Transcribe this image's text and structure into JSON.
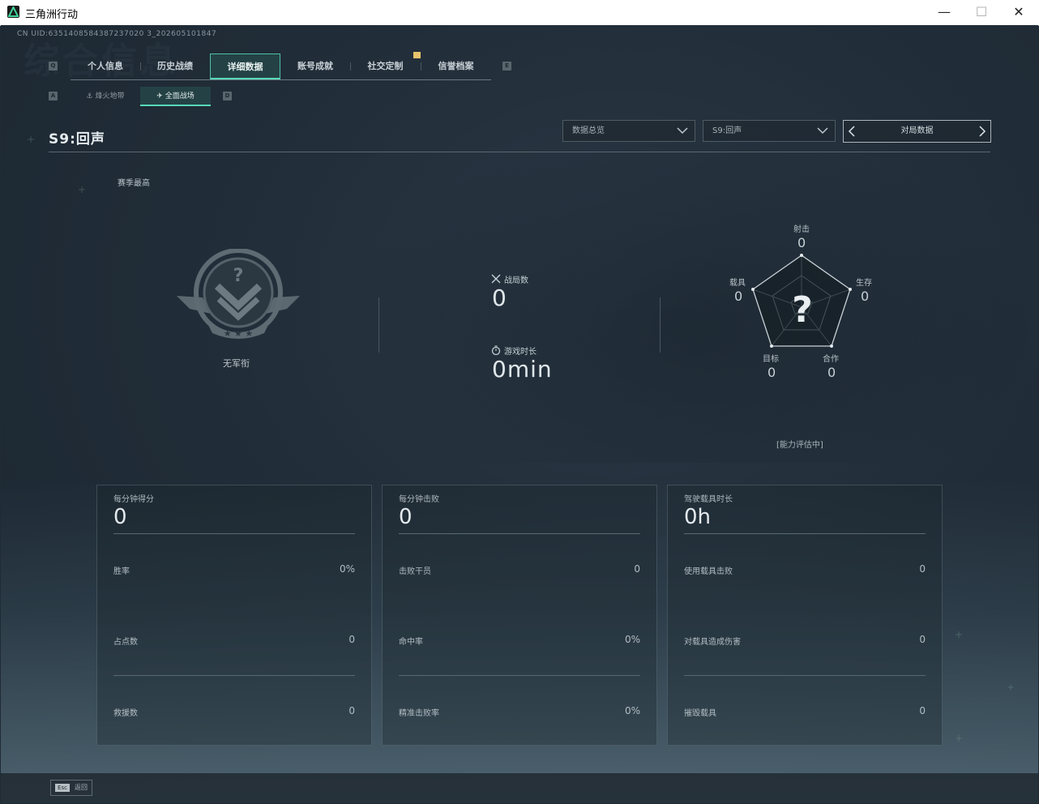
{
  "window": {
    "title": "三角洲行动",
    "min": "—",
    "max": "☐",
    "close": "✕"
  },
  "uid": "CN UID:6351408584387237020 3_202605101847",
  "watermark": "综合信息",
  "key_hints": {
    "tab_prev": "Q",
    "tab_next": "E",
    "sub_prev": "A",
    "sub_next": "D"
  },
  "tabs": [
    {
      "label": "个人信息"
    },
    {
      "label": "历史战绩"
    },
    {
      "label": "详细数据",
      "active": true
    },
    {
      "label": "账号成就"
    },
    {
      "label": "社交定制"
    },
    {
      "label": "信誉档案"
    }
  ],
  "subtabs": [
    {
      "label": "烽火地带",
      "icon": "anchor-icon"
    },
    {
      "label": "全面战场",
      "icon": "plane-icon",
      "active": true
    }
  ],
  "season": {
    "title": "S9:回声"
  },
  "filters": {
    "overview": "数据总览",
    "season": "S9:回声",
    "nav_label": "对局数据"
  },
  "summary": {
    "season_high": "赛季最高",
    "rank_name": "无军衔",
    "matches_label": "战局数",
    "matches_value": "0",
    "playtime_label": "游戏时长",
    "playtime_value": "0min"
  },
  "radar": {
    "center": "?",
    "axes": [
      {
        "label": "射击",
        "value": "0"
      },
      {
        "label": "生存",
        "value": "0"
      },
      {
        "label": "合作",
        "value": "0"
      },
      {
        "label": "目标",
        "value": "0"
      },
      {
        "label": "载具",
        "value": "0"
      }
    ],
    "status": "[能力评估中]"
  },
  "panels": [
    {
      "title": "每分钟得分",
      "value": "0",
      "rows": [
        {
          "label": "胜率",
          "value": "0%"
        },
        {
          "label": "占点数",
          "value": "0"
        },
        {
          "label": "救援数",
          "value": "0"
        }
      ]
    },
    {
      "title": "每分钟击败",
      "value": "0",
      "rows": [
        {
          "label": "击败干员",
          "value": "0"
        },
        {
          "label": "命中率",
          "value": "0%"
        },
        {
          "label": "精准击败率",
          "value": "0%"
        }
      ]
    },
    {
      "title": "驾驶载具时长",
      "value": "0h",
      "rows": [
        {
          "label": "使用载具击败",
          "value": "0"
        },
        {
          "label": "对载具造成伤害",
          "value": "0"
        },
        {
          "label": "摧毁载具",
          "value": "0"
        }
      ]
    }
  ],
  "footer": {
    "esc_key": "Esc",
    "esc_label": "返回"
  },
  "colors": {
    "accent": "#58d9b8",
    "notification": "#e6c36b",
    "background": "#1f2b35"
  }
}
